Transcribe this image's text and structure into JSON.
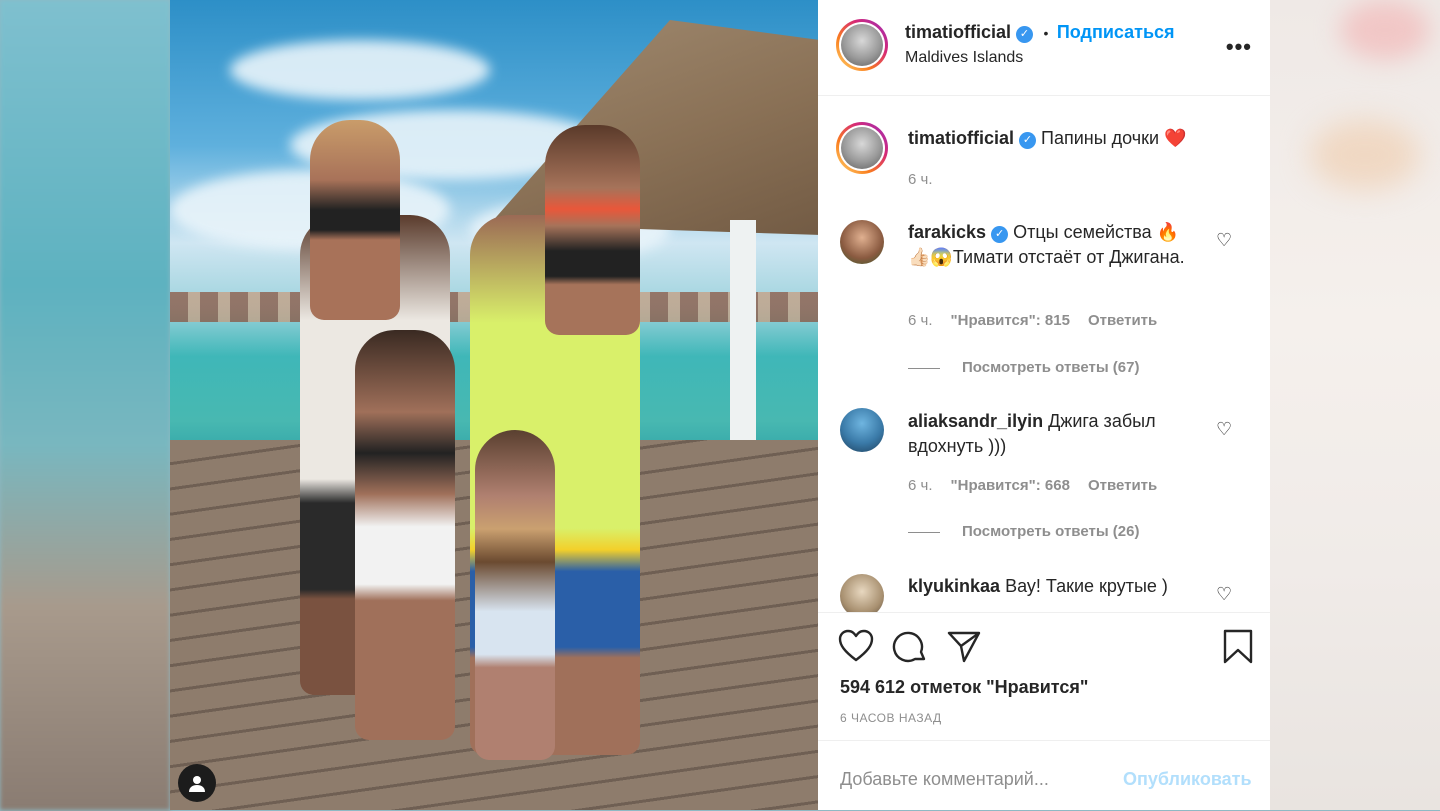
{
  "post": {
    "author": "timatiofficial",
    "follow_label": "Подписаться",
    "location": "Maldives Islands",
    "more_icon": "more-horizontal-icon",
    "verified_icon": "verified-badge-icon"
  },
  "caption": {
    "author": "timatiofficial",
    "text": "Папины дочки",
    "emoji": "❤️",
    "time": "6 ч."
  },
  "comments": [
    {
      "author": "farakicks",
      "text": "Отцы семейства 🔥 👍🏻😱Тимати отстаёт от Джигана.",
      "time": "6 ч.",
      "likes": "\"Нравится\": 815",
      "reply": "Ответить",
      "view_replies": "Посмотреть ответы (67)"
    },
    {
      "author": "aliaksandr_ilyin",
      "text": "Джига забыл вдохнуть )))",
      "time": "6 ч.",
      "likes": "\"Нравится\": 668",
      "reply": "Ответить",
      "view_replies": "Посмотреть ответы (26)"
    },
    {
      "author": "klyukinkaa",
      "text": "Вау! Такие крутые )",
      "time": "",
      "likes": "",
      "reply": "",
      "view_replies": ""
    }
  ],
  "actions": {
    "like_icon": "heart-icon",
    "comment_icon": "comment-icon",
    "share_icon": "paper-plane-icon",
    "save_icon": "bookmark-icon",
    "likes_count": "594 612 отметок \"Нравится\"",
    "time_ago": "6 ЧАСОВ НАЗАД"
  },
  "add_comment": {
    "placeholder": "Добавьте комментарий...",
    "publish_label": "Опубликовать"
  },
  "colors": {
    "accent": "#0095f6",
    "verified": "#3897f0",
    "muted": "#8e8e8e",
    "publish_disabled": "#b2dffc"
  }
}
